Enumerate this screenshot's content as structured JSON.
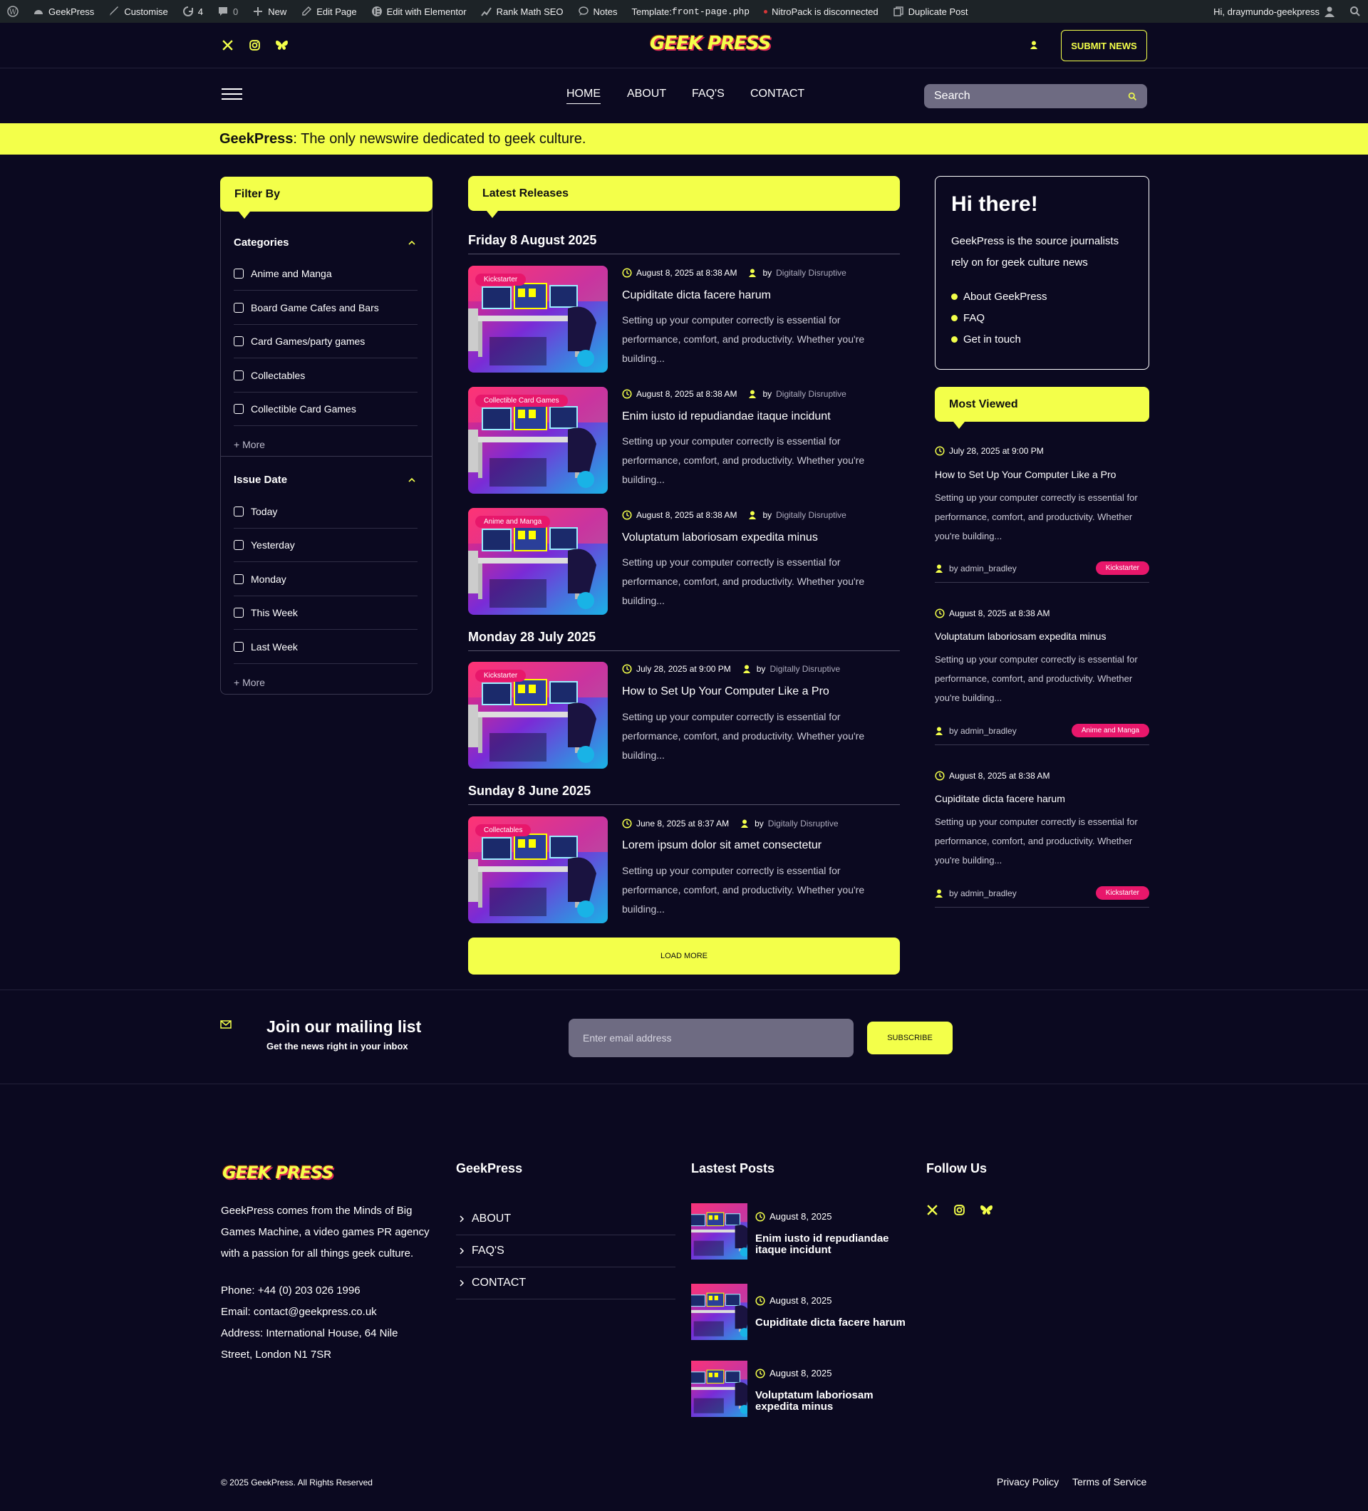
{
  "admin_bar": {
    "site": "GeekPress",
    "customise": "Customise",
    "updates": "4",
    "comments": "0",
    "new": "New",
    "edit_page": "Edit Page",
    "elementor": "Edit with Elementor",
    "rankmath": "Rank Math SEO",
    "notes": "Notes",
    "template_label": "Template:",
    "template_file": "front-page.php",
    "nitropack": "NitroPack is disconnected",
    "duplicate": "Duplicate Post",
    "greeting": "Hi, draymundo-geekpress"
  },
  "header": {
    "logo": "GEEK PRESS",
    "submit": "SUBMIT NEWS",
    "social_icons": [
      "x-icon",
      "instagram-icon",
      "bluesky-icon"
    ]
  },
  "nav": {
    "items": [
      "HOME",
      "ABOUT",
      "FAQ'S",
      "CONTACT"
    ],
    "active": "HOME",
    "search_placeholder": "Search"
  },
  "tagline": {
    "brand": "GeekPress",
    "text": ": The only newswire dedicated to geek culture."
  },
  "filter": {
    "title": "Filter By",
    "categories_title": "Categories",
    "categories": [
      "Anime and Manga",
      "Board Game Cafes and Bars",
      "Card Games/party games",
      "Collectables",
      "Collectible Card Games"
    ],
    "issue_title": "Issue Date",
    "issue_dates": [
      "Today",
      "Yesterday",
      "Monday",
      "This Week",
      "Last Week"
    ],
    "more": "+ More"
  },
  "feed": {
    "title": "Latest Releases",
    "days": [
      "Friday 8 August 2025",
      "Monday 28 July 2025",
      "Sunday 8 June 2025"
    ],
    "posts": [
      {
        "badge": "Kickstarter",
        "date": "August 8, 2025 at 8:38 AM",
        "by": "by",
        "author": "Digitally Disruptive",
        "title": "Cupiditate dicta facere harum",
        "excerpt": "Setting up your computer correctly is essential for performance, comfort, and productivity. Whether you're building..."
      },
      {
        "badge": "Collectible Card Games",
        "date": "August 8, 2025 at 8:38 AM",
        "by": "by",
        "author": "Digitally Disruptive",
        "title": "Enim iusto id repudiandae itaque incidunt",
        "excerpt": "Setting up your computer correctly is essential for performance, comfort, and productivity. Whether you're building..."
      },
      {
        "badge": "Anime and Manga",
        "date": "August 8, 2025 at 8:38 AM",
        "by": "by",
        "author": "Digitally Disruptive",
        "title": "Voluptatum laboriosam expedita minus",
        "excerpt": "Setting up your computer correctly is essential for performance, comfort, and productivity. Whether you're building..."
      },
      {
        "badge": "Kickstarter",
        "date": "July 28, 2025 at 9:00 PM",
        "by": "by",
        "author": "Digitally Disruptive",
        "title": "How to Set Up Your Computer Like a Pro",
        "excerpt": "Setting up your computer correctly is essential for performance, comfort, and productivity. Whether you're building..."
      },
      {
        "badge": "Collectables",
        "date": "June 8, 2025 at 8:37 AM",
        "by": "by",
        "author": "Digitally Disruptive",
        "title": "Lorem ipsum dolor sit amet consectetur",
        "excerpt": "Setting up your computer correctly is essential for performance, comfort, and productivity. Whether you're building..."
      }
    ],
    "load_more": "LOAD MORE"
  },
  "hi_box": {
    "title": "Hi there!",
    "text": "GeekPress is the source journalists rely on for geek culture news",
    "links": [
      "About GeekPress",
      "FAQ",
      "Get in touch"
    ]
  },
  "most_viewed": {
    "title": "Most Viewed",
    "items": [
      {
        "date": "July 28, 2025 at 9:00 PM",
        "title": "How to Set Up Your Computer Like a Pro",
        "excerpt": "Setting up your computer correctly is essential for performance, comfort, and productivity. Whether you're building...",
        "author": "by admin_bradley",
        "tag": "Kickstarter"
      },
      {
        "date": "August 8, 2025 at 8:38 AM",
        "title": "Voluptatum laboriosam expedita minus",
        "excerpt": "Setting up your computer correctly is essential for performance, comfort, and productivity. Whether you're building...",
        "author": "by admin_bradley",
        "tag": "Anime and Manga"
      },
      {
        "date": "August 8, 2025 at 8:38 AM",
        "title": "Cupiditate dicta facere harum",
        "excerpt": "Setting up your computer correctly is essential for performance, comfort, and productivity. Whether you're building...",
        "author": "by admin_bradley",
        "tag": "Kickstarter"
      }
    ]
  },
  "mailing": {
    "title": "Join our mailing list",
    "subtitle": "Get the news right in your inbox",
    "placeholder": "Enter email address",
    "button": "SUBSCRIBE"
  },
  "footer": {
    "about": "GeekPress comes from the Minds of Big Games Machine, a video games PR agency with a passion for all things geek culture.",
    "phone": "Phone: +44 (0) 203 026 1996",
    "email": "Email: contact@geekpress.co.uk",
    "address": "Address: International House, 64 Nile Street, London N1 7SR",
    "col2_title": "GeekPress",
    "links": [
      "ABOUT",
      "FAQ'S",
      "CONTACT"
    ],
    "col3_title": "Lastest Posts",
    "latest": [
      {
        "date": "August 8, 2025",
        "title": "Enim iusto id repudiandae itaque incidunt"
      },
      {
        "date": "August 8, 2025",
        "title": "Cupiditate dicta facere harum"
      },
      {
        "date": "August 8, 2025",
        "title": "Voluptatum laboriosam expedita minus"
      }
    ],
    "col4_title": "Follow Us",
    "copyright": "© 2025 GeekPress. All Rights Reserved",
    "privacy": "Privacy Policy",
    "terms": "Terms of Service"
  },
  "colors": {
    "accent": "#f3ff4a",
    "background": "#0b0920",
    "badge": "#e8176b"
  }
}
